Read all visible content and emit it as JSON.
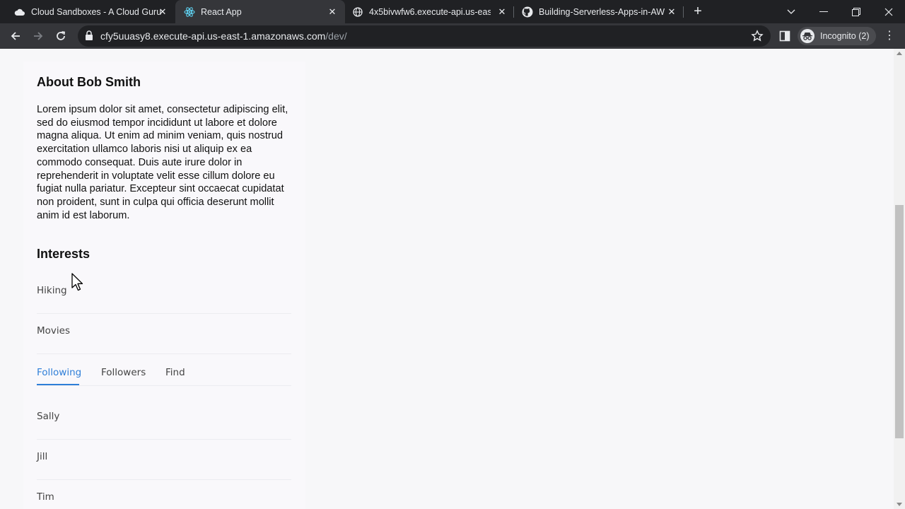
{
  "browser": {
    "tabs": [
      {
        "title": "Cloud Sandboxes - A Cloud Guru",
        "icon": "cloud-icon",
        "active": false
      },
      {
        "title": "React App",
        "icon": "react-icon",
        "active": true
      },
      {
        "title": "4x5bivwfw6.execute-api.us-east-",
        "icon": "globe-icon",
        "active": false
      },
      {
        "title": "Building-Serverless-Apps-in-AWS",
        "icon": "github-icon",
        "active": false
      }
    ],
    "url_host": "cfy5uuasy8.execute-api.us-east-1.amazonaws.com",
    "url_path": "/dev/",
    "profile_label": "Incognito (2)"
  },
  "page": {
    "about_heading": "About Bob Smith",
    "about_text": "Lorem ipsum dolor sit amet, consectetur adipiscing elit, sed do eiusmod tempor incididunt ut labore et dolore magna aliqua. Ut enim ad minim veniam, quis nostrud exercitation ullamco laboris nisi ut aliquip ex ea commodo consequat. Duis aute irure dolor in reprehenderit in voluptate velit esse cillum dolore eu fugiat nulla pariatur. Excepteur sint occaecat cupidatat non proident, sunt in culpa qui officia deserunt mollit anim id est laborum.",
    "interests_heading": "Interests",
    "interests": [
      "Hiking",
      "Movies"
    ],
    "tabs": [
      "Following",
      "Followers",
      "Find"
    ],
    "active_tab": "Following",
    "following": [
      "Sally",
      "Jill",
      "Tim"
    ]
  },
  "colors": {
    "accent": "#2f7fd8",
    "chrome_dark": "#202124",
    "chrome_toolbar": "#35363a"
  }
}
